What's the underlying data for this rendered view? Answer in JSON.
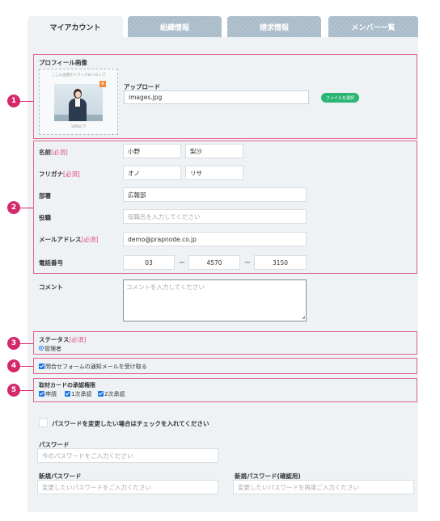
{
  "tabs": [
    {
      "label": "マイアカウント",
      "active": true
    },
    {
      "label": "組織情報",
      "active": false
    },
    {
      "label": "請求情報",
      "active": false
    },
    {
      "label": "メンバー一覧",
      "active": false
    }
  ],
  "markers": [
    "1",
    "2",
    "3",
    "4",
    "5"
  ],
  "profile": {
    "section_label": "プロフィール画像",
    "drop_text": "ここに画像をドラッグ&ドロップ",
    "size_note": "1MB以下",
    "upload_label": "アップロード",
    "file_name": "images.jpg",
    "file_button": "ファイルを選択"
  },
  "form": {
    "name_label": "名前",
    "name_req": "[必須]",
    "last_name": "小野",
    "first_name": "梨沙",
    "kana_label": "フリガナ",
    "kana_req": "[必須]",
    "kana_last": "オノ",
    "kana_first": "リサ",
    "dept_label": "部署",
    "dept_value": "広報部",
    "title_label": "役職",
    "title_placeholder": "役職名を入力してください",
    "email_label": "メールアドレス",
    "email_req": "[必須]",
    "email_value": "demo@prapnode.co.jp",
    "phone_label": "電話番号",
    "phone_1": "03",
    "phone_2": "4570",
    "phone_3": "3150",
    "phone_sep": "ー",
    "comment_label": "コメント",
    "comment_placeholder": "コメントを入力してください"
  },
  "status": {
    "label": "ステータス",
    "req": "[必須]",
    "value": "管理者"
  },
  "notify": {
    "label": "問合せフォームの通知メールを受け取る"
  },
  "approval": {
    "label": "取材カードの承認権限",
    "options": [
      "申請",
      "1次承認",
      "2次承認"
    ]
  },
  "password": {
    "change_label": "パスワードを変更したい場合はチェックを入れてください",
    "current_label": "パスワード",
    "current_placeholder": "今のパスワードをご入力ください",
    "new_label": "新規パスワード",
    "new_placeholder": "変更したいパスワードをご入力ください",
    "confirm_label": "新規パスワード(確認用)",
    "confirm_placeholder": "変更したいパスワードを再度ご入力ください"
  },
  "colors": {
    "accent_red": "#d4296b",
    "outline_pink": "#e06a8c",
    "file_button_green": "#2bb673",
    "tab_inactive": "#a9bcc9",
    "panel_bg": "#eef2f5"
  }
}
